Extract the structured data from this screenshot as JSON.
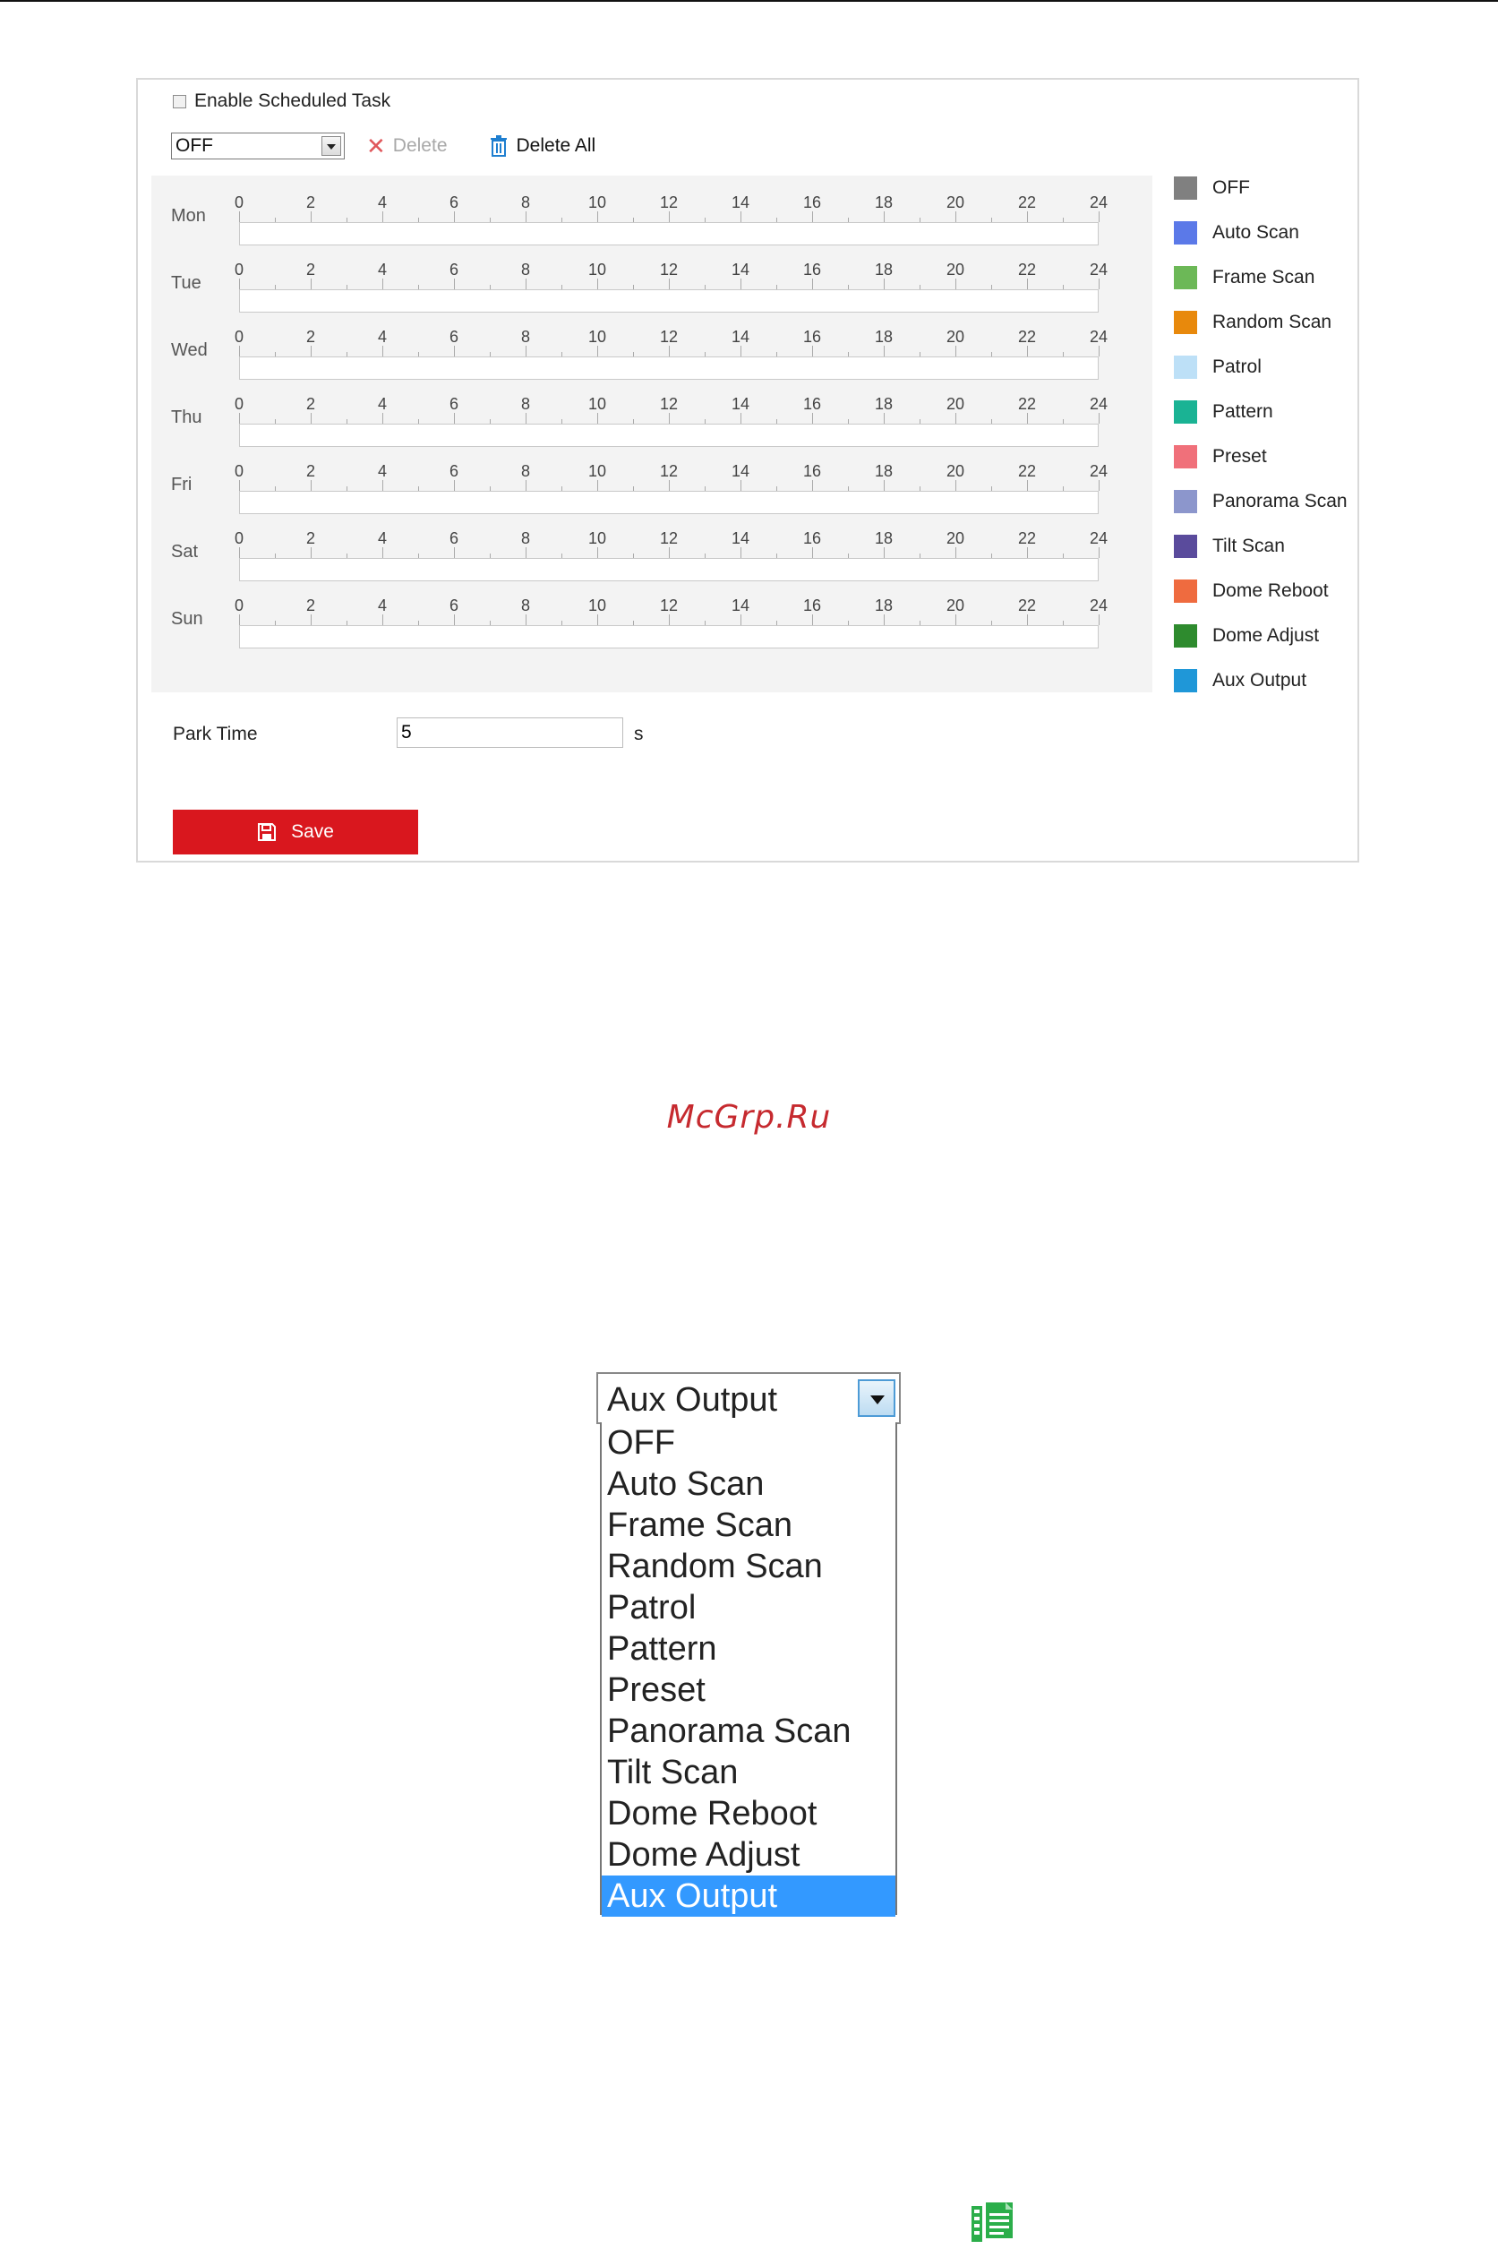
{
  "scheduler": {
    "enable_label": "Enable Scheduled Task",
    "task_select_value": "OFF",
    "delete_label": "Delete",
    "delete_all_label": "Delete All",
    "hour_ticks": [
      "0",
      "2",
      "4",
      "6",
      "8",
      "10",
      "12",
      "14",
      "16",
      "18",
      "20",
      "22",
      "24"
    ],
    "days": [
      "Mon",
      "Tue",
      "Wed",
      "Thu",
      "Fri",
      "Sat",
      "Sun"
    ],
    "legend": [
      {
        "label": "OFF",
        "color": "#808080"
      },
      {
        "label": "Auto Scan",
        "color": "#5b79e8"
      },
      {
        "label": "Frame Scan",
        "color": "#6cb857"
      },
      {
        "label": "Random Scan",
        "color": "#e8890c"
      },
      {
        "label": "Patrol",
        "color": "#bde0f7"
      },
      {
        "label": "Pattern",
        "color": "#1ab394"
      },
      {
        "label": "Preset",
        "color": "#f0707a"
      },
      {
        "label": "Panorama Scan",
        "color": "#8c96cc"
      },
      {
        "label": "Tilt Scan",
        "color": "#5a4b9c"
      },
      {
        "label": "Dome Reboot",
        "color": "#ef6b3f"
      },
      {
        "label": "Dome Adjust",
        "color": "#2e8b2e"
      },
      {
        "label": "Aux Output",
        "color": "#1f97d8"
      }
    ],
    "park_time_label": "Park Time",
    "park_time_value": "5",
    "park_time_unit": "s",
    "save_label": "Save"
  },
  "watermark": "McGrp.Ru",
  "dropdown": {
    "selected": "Aux Output",
    "options": [
      "OFF",
      "Auto Scan",
      "Frame Scan",
      "Random Scan",
      "Patrol",
      "Pattern",
      "Preset",
      "Panorama Scan",
      "Tilt Scan",
      "Dome Reboot",
      "Dome Adjust",
      "Aux Output"
    ],
    "highlighted_index": 11,
    "highlight_color": "#3399ff"
  }
}
